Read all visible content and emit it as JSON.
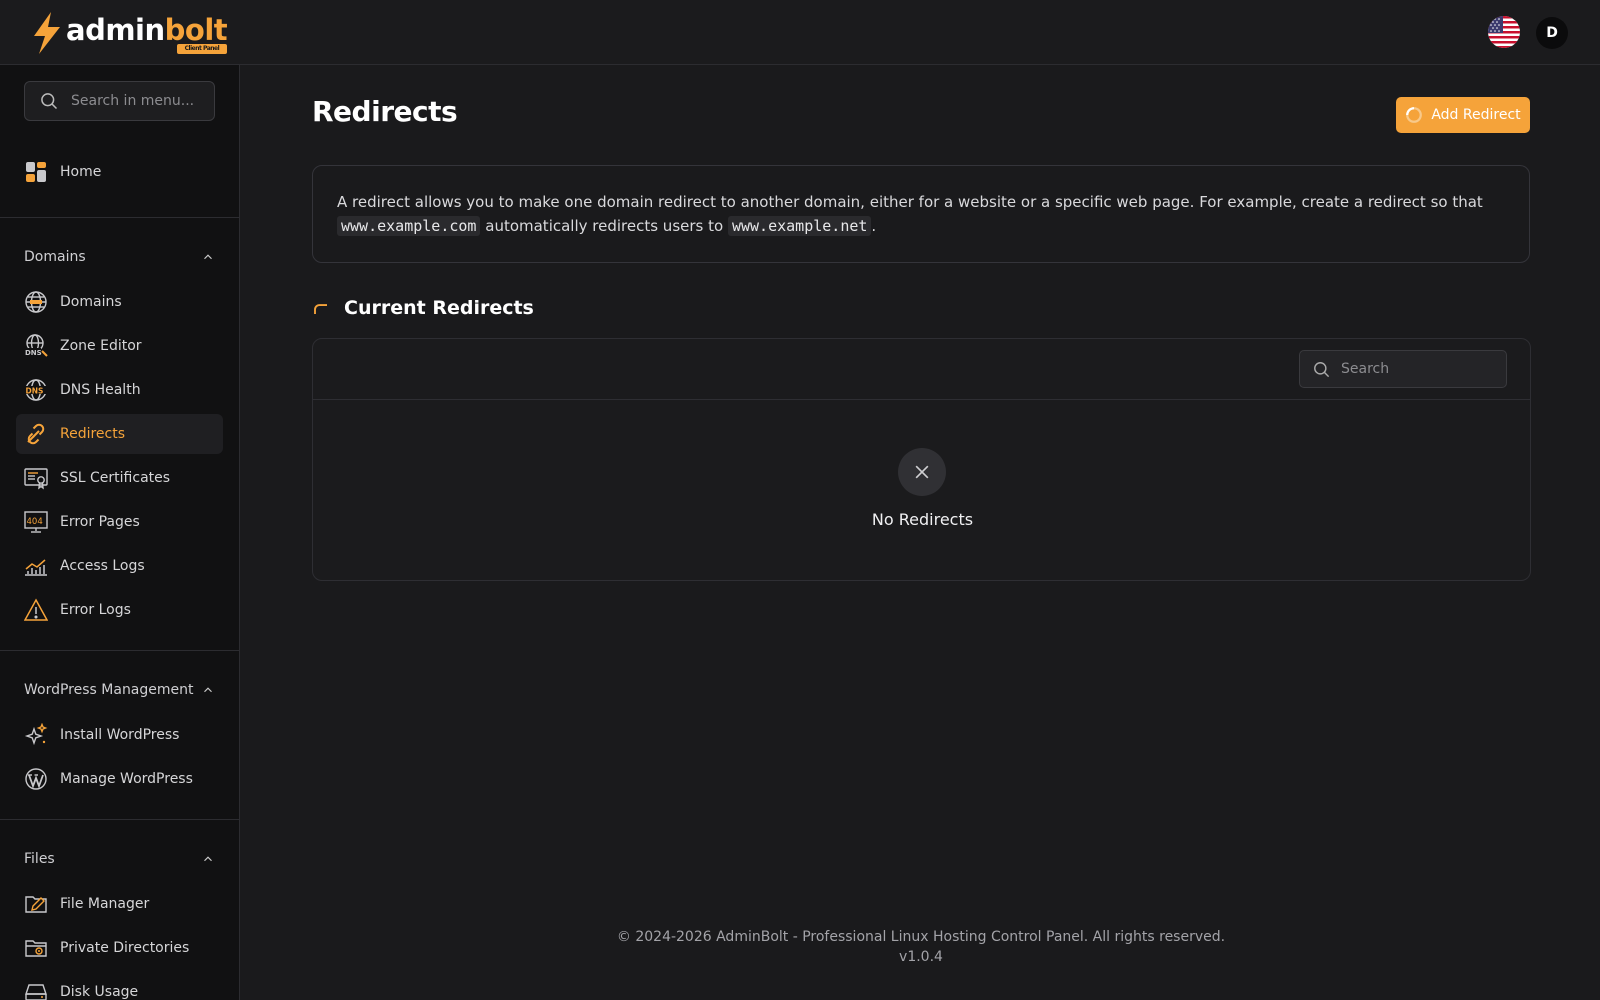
{
  "brand": {
    "name_part1": "admin",
    "name_part2": "bolt",
    "badge": "Client Panel",
    "accent": "#f5a33a"
  },
  "header": {
    "avatar_initial": "D",
    "language_icon": "us-flag-icon"
  },
  "sidebar": {
    "search_placeholder": "Search in menu...",
    "home": {
      "label": "Home",
      "icon": "home-grid-icon"
    },
    "sections": [
      {
        "title": "Domains",
        "items": [
          {
            "label": "Domains",
            "icon": "globe-icon"
          },
          {
            "label": "Zone Editor",
            "icon": "dns-zone-icon"
          },
          {
            "label": "DNS Health",
            "icon": "dns-globe-icon"
          },
          {
            "label": "Redirects",
            "icon": "link-icon",
            "active": true
          },
          {
            "label": "SSL Certificates",
            "icon": "certificate-icon"
          },
          {
            "label": "Error Pages",
            "icon": "404-monitor-icon"
          },
          {
            "label": "Access Logs",
            "icon": "chart-icon"
          },
          {
            "label": "Error Logs",
            "icon": "warning-icon"
          }
        ]
      },
      {
        "title": "WordPress Management",
        "items": [
          {
            "label": "Install WordPress",
            "icon": "sparkle-icon"
          },
          {
            "label": "Manage WordPress",
            "icon": "wordpress-icon"
          }
        ]
      },
      {
        "title": "Files",
        "items": [
          {
            "label": "File Manager",
            "icon": "folder-edit-icon"
          },
          {
            "label": "Private Directories",
            "icon": "folder-lock-icon"
          },
          {
            "label": "Disk Usage",
            "icon": "disk-icon"
          }
        ]
      }
    ]
  },
  "main": {
    "title": "Redirects",
    "add_button": "Add Redirect",
    "info": {
      "text_before": "A redirect allows you to make one domain redirect to another domain, either for a website or a specific web page. For example, create a redirect so that",
      "code1": "www.example.com",
      "text_middle": "automatically redirects users to",
      "code2": "www.example.net",
      "text_after": "."
    },
    "section_title": "Current Redirects",
    "table_search_placeholder": "Search",
    "empty_text": "No Redirects"
  },
  "footer": {
    "copyright": "© 2024-2026 AdminBolt - Professional Linux Hosting Control Panel. All rights reserved.",
    "version": "v1.0.4"
  }
}
